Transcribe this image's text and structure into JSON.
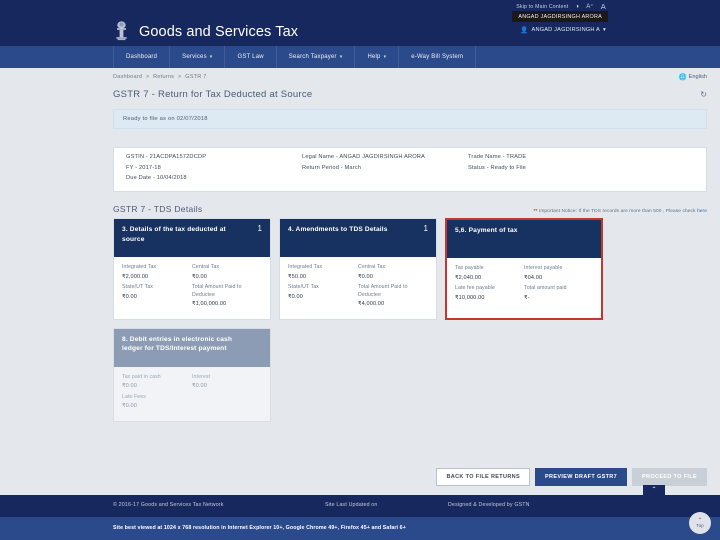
{
  "utility": {
    "skip_label": "Skip to Main Content",
    "icons": [
      "contrast-icon",
      "font-increase-icon",
      "font-decrease-icon"
    ],
    "a_large": "A",
    "a_small": "A",
    "tooltip": "ANGAD JAGDIRSINGH ARORA",
    "user_name": "ANGAD JAGDIRSINGH A",
    "user_caret": "▾"
  },
  "header": {
    "emblem": "india-emblem-icon",
    "title": "Goods and Services Tax"
  },
  "nav": {
    "items": [
      {
        "label": "Dashboard",
        "caret": ""
      },
      {
        "label": "Services",
        "caret": "▾"
      },
      {
        "label": "GST Law",
        "caret": ""
      },
      {
        "label": "Search Taxpayer",
        "caret": "▾"
      },
      {
        "label": "Help",
        "caret": "▾"
      },
      {
        "label": "e-Way Bill System",
        "caret": ""
      }
    ]
  },
  "breadcrumb": {
    "items": [
      "Dashboard",
      "Returns",
      "GSTR 7"
    ],
    "separator": ">"
  },
  "language": {
    "icon": "globe-icon",
    "label": "English"
  },
  "page": {
    "title": "GSTR 7 - Return for Tax Deducted at Source",
    "refresh_icon": "refresh-icon",
    "ready_status": "Ready to file as on 02/07/2018"
  },
  "taxpayer_info": {
    "col1": [
      "GSTIN - 21ACDPA1572DCDP",
      "FY - 2017-18",
      "Due Date - 10/04/2018"
    ],
    "col2": [
      "Legal Name - ANGAD JAGDIRSINGH ARORA",
      "Return Period - March"
    ],
    "col3": [
      "Trade Name - TRADE",
      "Status - Ready to File"
    ]
  },
  "section": {
    "title": "GSTR 7 - TDS Details",
    "notice_asterisk": "**",
    "notice_text": " Important Notice: If the TDS records are more than 500 , Please check ",
    "notice_link": "here"
  },
  "cards": [
    {
      "title": "3. Details of the tax deducted at source",
      "count": "1",
      "state": "active",
      "fields": [
        {
          "label": "Integrated Tax",
          "value": "₹2,000.00"
        },
        {
          "label": "Central Tax",
          "value": "₹0.00"
        },
        {
          "label": "State/UT Tax",
          "value": "₹0.00"
        },
        {
          "label": "Total Amount Paid to Deductee",
          "value": "₹1,00,000.00"
        }
      ]
    },
    {
      "title": "4. Amendments to TDS Details",
      "count": "1",
      "state": "active",
      "fields": [
        {
          "label": "Integrated Tax",
          "value": "₹50.00"
        },
        {
          "label": "Central Tax",
          "value": "₹0.00"
        },
        {
          "label": "State/UT Tax",
          "value": "₹0.00"
        },
        {
          "label": "Total Amount Paid to Deductee",
          "value": "₹4,000.00"
        }
      ]
    },
    {
      "title": "5,6. Payment of tax",
      "count": "",
      "state": "selected",
      "fields": [
        {
          "label": "Tax payable",
          "value": "₹2,040.00"
        },
        {
          "label": "Interest payable",
          "value": "₹04.00"
        },
        {
          "label": "Late fee payable",
          "value": "₹10,000.00"
        },
        {
          "label": "Total amount paid",
          "value": "₹-"
        }
      ]
    },
    {
      "title": "8. Debit entries in electronic cash ledger for TDS/Interest payment",
      "count": "",
      "state": "muted",
      "fields": [
        {
          "label": "Tax paid in cash",
          "value": "₹0.00"
        },
        {
          "label": "Interest",
          "value": "₹0.00"
        },
        {
          "label": "Late Fees",
          "value": "₹0.00"
        },
        {
          "label": "",
          "value": ""
        }
      ]
    }
  ],
  "actions": {
    "back": "BACK TO FILE RETURNS",
    "preview": "PREVIEW DRAFT GSTR7",
    "proceed": "PROCEED TO FILE"
  },
  "footer": {
    "copyright": "© 2016-17 Goods and Services Tax Network",
    "last_updated": "Site Last Updated on",
    "developed": "Designed & Developed by GSTN",
    "compat": "Site best viewed at 1024 x 768 resolution in Internet Explorer 10+, Google Chrome 49+, Firefox 45+ and Safari 6+"
  },
  "scroll_top": {
    "arrow": "⌃",
    "label": "Top"
  }
}
